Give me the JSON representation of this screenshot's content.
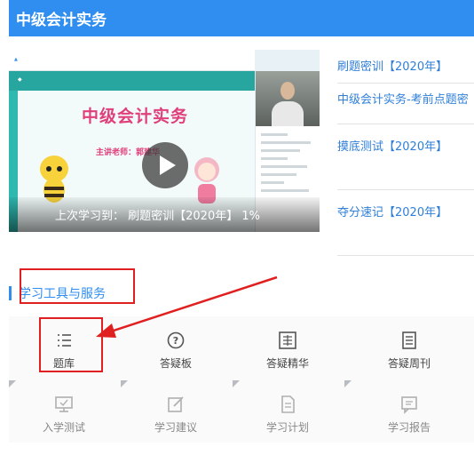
{
  "header": {
    "title": "中级会计实务"
  },
  "video": {
    "slide_title": "中级会计实务",
    "teacher_line": "主讲老师：郭建华",
    "resume_text": "上次学习到：  刷题密训【2020年】  1%"
  },
  "courses": [
    {
      "label": "刷题密训【2020年】"
    },
    {
      "label": "中级会计实务-考前点题密"
    },
    {
      "label": "摸底测试【2020年】"
    },
    {
      "label": "夺分速记【2020年】"
    }
  ],
  "tools": {
    "section_title": "学习工具与服务",
    "items": [
      {
        "label": "题库",
        "icon": "list-icon",
        "enabled": true
      },
      {
        "label": "答疑板",
        "icon": "question-icon",
        "enabled": true
      },
      {
        "label": "答疑精华",
        "icon": "essence-icon",
        "enabled": true
      },
      {
        "label": "答疑周刊",
        "icon": "document-icon",
        "enabled": true
      },
      {
        "label": "入学测试",
        "icon": "monitor-icon",
        "enabled": false
      },
      {
        "label": "学习建议",
        "icon": "edit-icon",
        "enabled": false
      },
      {
        "label": "学习计划",
        "icon": "file-icon",
        "enabled": false
      },
      {
        "label": "学习报告",
        "icon": "report-icon",
        "enabled": false
      }
    ]
  },
  "colors": {
    "brand_blue": "#2f8ef0",
    "link_blue": "#2f7fd8",
    "annotation_red": "#e02020"
  }
}
